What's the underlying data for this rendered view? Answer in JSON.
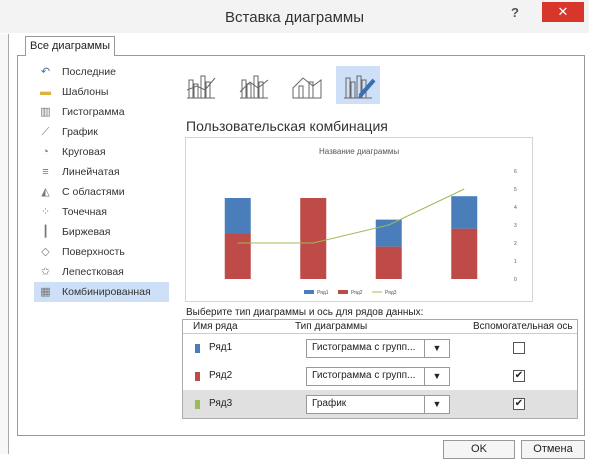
{
  "window": {
    "title": "Вставка диаграммы",
    "help": "?",
    "close": "✕"
  },
  "tab_label": "Все диаграммы",
  "chart_types": [
    {
      "label": "Последние",
      "icon": "recent-icon"
    },
    {
      "label": "Шаблоны",
      "icon": "folder-icon"
    },
    {
      "label": "Гистограмма",
      "icon": "column-chart-icon"
    },
    {
      "label": "График",
      "icon": "line-chart-icon"
    },
    {
      "label": "Круговая",
      "icon": "pie-chart-icon"
    },
    {
      "label": "Линейчатая",
      "icon": "bar-chart-icon"
    },
    {
      "label": "С областями",
      "icon": "area-chart-icon"
    },
    {
      "label": "Точечная",
      "icon": "scatter-chart-icon"
    },
    {
      "label": "Биржевая",
      "icon": "stock-chart-icon"
    },
    {
      "label": "Поверхность",
      "icon": "surface-chart-icon"
    },
    {
      "label": "Лепестковая",
      "icon": "radar-chart-icon"
    },
    {
      "label": "Комбинированная",
      "icon": "combo-chart-icon",
      "selected": true
    }
  ],
  "subtitle": "Пользовательская комбинация",
  "chart_data": {
    "type": "bar",
    "title": "Название диаграммы",
    "categories": [
      "",
      "",
      "",
      ""
    ],
    "series": [
      {
        "name": "Ряд1",
        "type": "bar",
        "values": [
          2.0,
          0,
          1.5,
          1.8
        ],
        "color": "#4a7ebb"
      },
      {
        "name": "Ряд2",
        "type": "bar",
        "values": [
          2.5,
          4.5,
          1.8,
          2.8
        ],
        "color": "#be4b48"
      },
      {
        "name": "Ряд3",
        "type": "line",
        "values": [
          2,
          2,
          3,
          5
        ],
        "color": "#9bbb59"
      }
    ],
    "ylim": [
      0,
      6
    ],
    "y2_ticks": [
      "0",
      "1",
      "2",
      "3",
      "4",
      "5",
      "6"
    ],
    "legend": [
      "Ряд1",
      "Ряд2",
      "Ряд3"
    ],
    "legend_position": "bottom",
    "grid": false
  },
  "series_table": {
    "title": "Выберите тип диаграммы и ось для рядов данных:",
    "headers": {
      "name": "Имя ряда",
      "type": "Тип диаграммы",
      "axis": "Вспомогательная ось"
    },
    "rows": [
      {
        "name": "Ряд1",
        "type": "Гистограмма с групп...",
        "secondary": false,
        "color": "#4a7ebb"
      },
      {
        "name": "Ряд2",
        "type": "Гистограмма с групп...",
        "secondary": true,
        "color": "#be4b48"
      },
      {
        "name": "Ряд3",
        "type": "График",
        "secondary": true,
        "color": "#9bbb59",
        "selected": true
      }
    ]
  },
  "buttons": {
    "ok": "OK",
    "cancel": "Отмена"
  }
}
